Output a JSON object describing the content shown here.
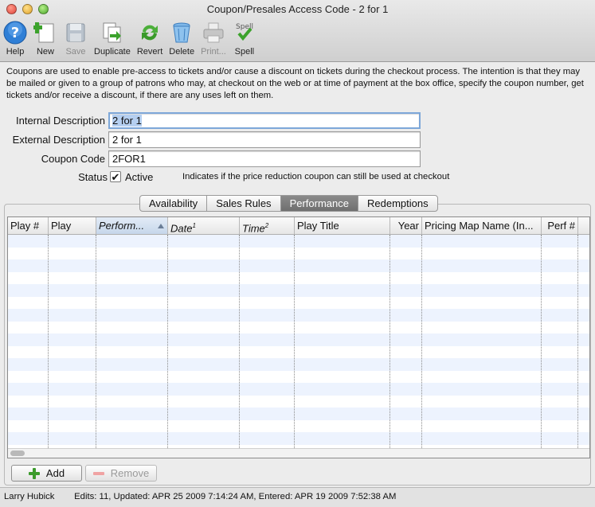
{
  "window": {
    "title": "Coupon/Presales Access Code - 2 for 1"
  },
  "toolbar": {
    "items": [
      {
        "label": "Help",
        "icon": "help-icon"
      },
      {
        "label": "New",
        "icon": "new-document-icon"
      },
      {
        "label": "Save",
        "icon": "save-disk-icon"
      },
      {
        "label": "Duplicate",
        "icon": "duplicate-icon"
      },
      {
        "label": "Revert",
        "icon": "revert-arrows-icon"
      },
      {
        "label": "Delete",
        "icon": "trash-can-icon"
      },
      {
        "label": "Print...",
        "icon": "printer-icon"
      },
      {
        "label": "Spell",
        "icon": "spell-check-icon",
        "icon_text": "Spell"
      }
    ]
  },
  "description": "Coupons are used to enable pre-access to tickets and/or cause a discount on tickets during the checkout process.  The intention is that they may be mailed or given to a group of patrons who may, at checkout on the web or at time of payment at the box office, specify the coupon number, get tickets and/or receive a discount, if there are any uses left on them.",
  "form": {
    "internal_label": "Internal Description",
    "internal_value": "2 for 1",
    "external_label": "External Description",
    "external_value": "2 for 1",
    "coupon_label": "Coupon Code",
    "coupon_value": "2FOR1",
    "status_label": "Status",
    "active_label": "Active",
    "active_checked": true,
    "status_note": "Indicates if the price reduction coupon can still be used at checkout"
  },
  "tabs": [
    {
      "label": "Availability",
      "selected": false
    },
    {
      "label": "Sales Rules",
      "selected": false
    },
    {
      "label": "Performance",
      "selected": true
    },
    {
      "label": "Redemptions",
      "selected": false
    }
  ],
  "table": {
    "columns": [
      {
        "label": "Play #"
      },
      {
        "label": "Play"
      },
      {
        "label": "Perform...",
        "sorted": true
      },
      {
        "label": "Date",
        "sup": "1"
      },
      {
        "label": "Time",
        "sup": "2"
      },
      {
        "label": "Play Title"
      },
      {
        "label": "Year"
      },
      {
        "label": "Pricing Map Name (In..."
      },
      {
        "label": "Perf #"
      }
    ],
    "rows": []
  },
  "buttons": {
    "add": "Add",
    "remove": "Remove"
  },
  "statusbar": {
    "user": "Larry Hubick",
    "info": "Edits: 11, Updated: APR 25 2009 7:14:24 AM, Entered: APR 19 2009 7:52:38 AM"
  },
  "colors": {
    "selected_tab": "#7a7a7a",
    "row_stripe": "#edf3fe",
    "focus_ring": "#7da7d9"
  }
}
